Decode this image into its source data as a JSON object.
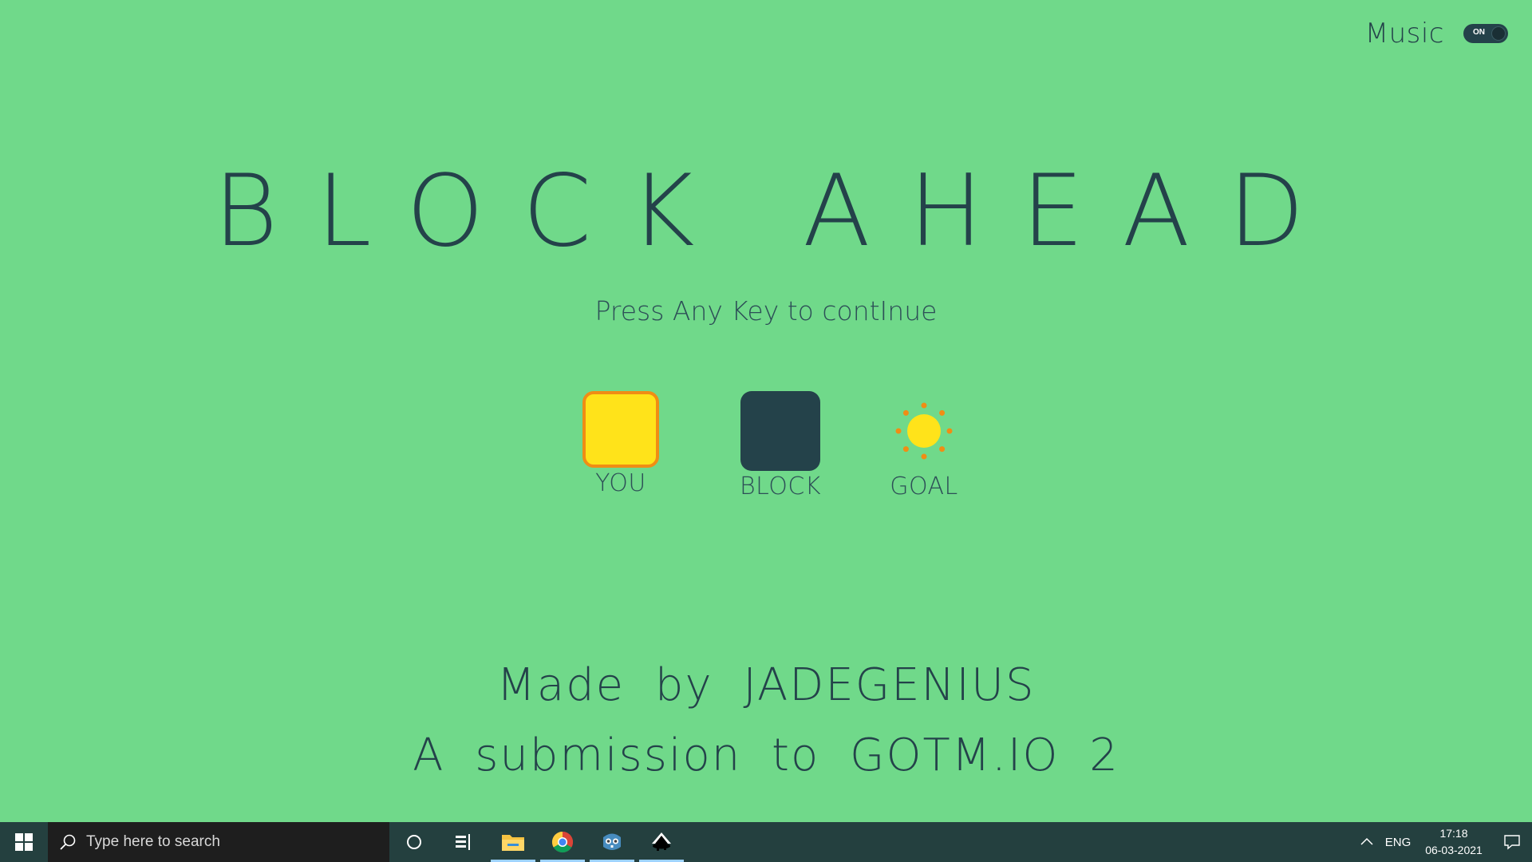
{
  "game": {
    "title": "BLOCK AHEAD",
    "subtitle": "Press Any Key to contInue",
    "music": {
      "label": "Music",
      "toggle_state": "ON"
    },
    "legend": [
      {
        "label": "YOU",
        "icon": "yellow-square-icon"
      },
      {
        "label": "BLOCK",
        "icon": "dark-square-icon"
      },
      {
        "label": "GOAL",
        "icon": "sun-icon"
      }
    ],
    "credits": {
      "line1": "Made by JADEGENIUS",
      "line2": "A submission to GOTM.IO 2"
    },
    "colors": {
      "background": "#70d98a",
      "ink": "#24424a",
      "you_fill": "#ffe31a",
      "you_border": "#f08d14",
      "goal_fill": "#ffe31a",
      "goal_rays": "#f08d14"
    }
  },
  "taskbar": {
    "search_placeholder": "Type here to search",
    "pinned": [
      {
        "name": "file-explorer",
        "active": true
      },
      {
        "name": "chrome",
        "active": true
      },
      {
        "name": "godot",
        "active": true
      },
      {
        "name": "inkscape",
        "active": true
      }
    ],
    "language": "ENG",
    "time": "17:18",
    "date": "06-03-2021"
  }
}
